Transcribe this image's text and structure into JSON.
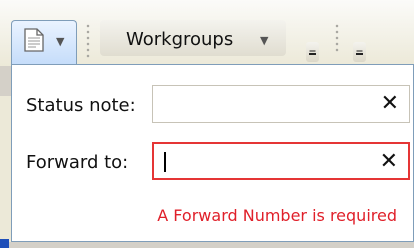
{
  "toolbar": {
    "workgroups_label": "Workgroups"
  },
  "form": {
    "status_note": {
      "label": "Status note:",
      "value": ""
    },
    "forward_to": {
      "label": "Forward to:",
      "value": ""
    },
    "clear_symbol": "✕",
    "error_message": "A Forward Number is required"
  },
  "colors": {
    "error": "#e53535",
    "accent_border": "#7f9db9"
  }
}
